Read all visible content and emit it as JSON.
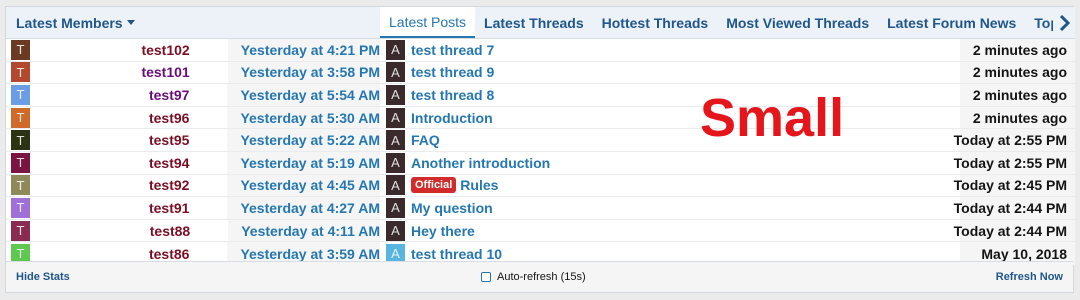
{
  "left": {
    "header": "Latest Members",
    "members": [
      {
        "initial": "T",
        "name": "test102",
        "time": "Yesterday at 4:21 PM",
        "avatar_color": "#6b3a25",
        "name_color": "#7a0e24"
      },
      {
        "initial": "T",
        "name": "test101",
        "time": "Yesterday at 3:58 PM",
        "avatar_color": "#b2482e",
        "name_color": "#6a0d78"
      },
      {
        "initial": "T",
        "name": "test97",
        "time": "Yesterday at 5:54 AM",
        "avatar_color": "#6b9de6",
        "name_color": "#6a0d78"
      },
      {
        "initial": "T",
        "name": "test96",
        "time": "Yesterday at 5:30 AM",
        "avatar_color": "#d06a2b",
        "name_color": "#7a0e24"
      },
      {
        "initial": "T",
        "name": "test95",
        "time": "Yesterday at 5:22 AM",
        "avatar_color": "#2b3312",
        "name_color": "#7a0e24"
      },
      {
        "initial": "T",
        "name": "test94",
        "time": "Yesterday at 5:19 AM",
        "avatar_color": "#7a1440",
        "name_color": "#7a0e24"
      },
      {
        "initial": "T",
        "name": "test92",
        "time": "Yesterday at 4:45 AM",
        "avatar_color": "#8e8a5c",
        "name_color": "#7a0e24"
      },
      {
        "initial": "T",
        "name": "test91",
        "time": "Yesterday at 4:27 AM",
        "avatar_color": "#a070d8",
        "name_color": "#7a0e24"
      },
      {
        "initial": "T",
        "name": "test88",
        "time": "Yesterday at 4:11 AM",
        "avatar_color": "#8a2b52",
        "name_color": "#7a0e24"
      },
      {
        "initial": "T",
        "name": "test86",
        "time": "Yesterday at 3:59 AM",
        "avatar_color": "#5fc850",
        "name_color": "#7a0e24"
      }
    ]
  },
  "right": {
    "tabs": [
      "Latest Posts",
      "Latest Threads",
      "Hottest Threads",
      "Most Viewed Threads",
      "Latest Forum News",
      "Top Reso"
    ],
    "active_tab": 0,
    "posts": [
      {
        "initial": "A",
        "title": "test thread 7",
        "badge": "",
        "time": "2 minutes ago",
        "avatar_color": "#3a2a2c"
      },
      {
        "initial": "A",
        "title": "test thread 9",
        "badge": "",
        "time": "2 minutes ago",
        "avatar_color": "#3a2a2c"
      },
      {
        "initial": "A",
        "title": "test thread 8",
        "badge": "",
        "time": "2 minutes ago",
        "avatar_color": "#3a2a2c"
      },
      {
        "initial": "A",
        "title": "Introduction",
        "badge": "",
        "time": "2 minutes ago",
        "avatar_color": "#3a2a2c"
      },
      {
        "initial": "A",
        "title": "FAQ",
        "badge": "",
        "time": "Today at 2:55 PM",
        "avatar_color": "#3a2a2c"
      },
      {
        "initial": "A",
        "title": "Another introduction",
        "badge": "",
        "time": "Today at 2:55 PM",
        "avatar_color": "#3a2a2c"
      },
      {
        "initial": "A",
        "title": "Rules",
        "badge": "Official",
        "time": "Today at 2:45 PM",
        "avatar_color": "#3a2a2c"
      },
      {
        "initial": "A",
        "title": "My question",
        "badge": "",
        "time": "Today at 2:44 PM",
        "avatar_color": "#3a2a2c"
      },
      {
        "initial": "A",
        "title": "Hey there",
        "badge": "",
        "time": "Today at 2:44 PM",
        "avatar_color": "#3a2a2c"
      },
      {
        "initial": "A",
        "title": "test thread 10",
        "badge": "",
        "time": "May 10, 2018",
        "avatar_color": "#5ab4e0"
      }
    ]
  },
  "overlay": "Small",
  "footer": {
    "hide_stats": "Hide Stats",
    "autorefresh": "Auto-refresh (15s)",
    "refresh_now": "Refresh Now"
  }
}
